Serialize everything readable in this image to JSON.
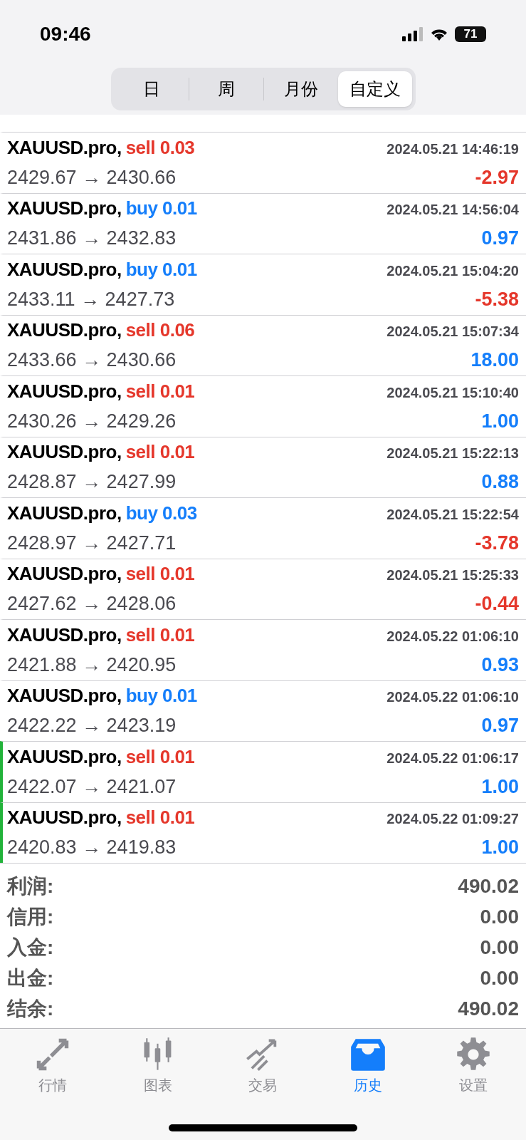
{
  "status_bar": {
    "time": "09:46",
    "battery": "71"
  },
  "period_tabs": [
    {
      "label": "日",
      "selected": false
    },
    {
      "label": "周",
      "selected": false
    },
    {
      "label": "月份",
      "selected": false
    },
    {
      "label": "自定义",
      "selected": true
    }
  ],
  "deals": [
    {
      "symbol": "XAUUSD.pro,",
      "sell": true,
      "lots": "sell 0.03",
      "time": "2024.05.21 14:46:19",
      "prices": "2429.67 → 2430.66",
      "profit": "-2.97",
      "loss": true,
      "marked": false
    },
    {
      "symbol": "XAUUSD.pro,",
      "sell": false,
      "lots": "buy 0.01",
      "time": "2024.05.21 14:56:04",
      "prices": "2431.86 → 2432.83",
      "profit": "0.97",
      "loss": false,
      "marked": false
    },
    {
      "symbol": "XAUUSD.pro,",
      "sell": false,
      "lots": "buy 0.01",
      "time": "2024.05.21 15:04:20",
      "prices": "2433.11 → 2427.73",
      "profit": "-5.38",
      "loss": true,
      "marked": false
    },
    {
      "symbol": "XAUUSD.pro,",
      "sell": true,
      "lots": "sell 0.06",
      "time": "2024.05.21 15:07:34",
      "prices": "2433.66 → 2430.66",
      "profit": "18.00",
      "loss": false,
      "marked": false
    },
    {
      "symbol": "XAUUSD.pro,",
      "sell": true,
      "lots": "sell 0.01",
      "time": "2024.05.21 15:10:40",
      "prices": "2430.26 → 2429.26",
      "profit": "1.00",
      "loss": false,
      "marked": false
    },
    {
      "symbol": "XAUUSD.pro,",
      "sell": true,
      "lots": "sell 0.01",
      "time": "2024.05.21 15:22:13",
      "prices": "2428.87 → 2427.99",
      "profit": "0.88",
      "loss": false,
      "marked": false
    },
    {
      "symbol": "XAUUSD.pro,",
      "sell": false,
      "lots": "buy 0.03",
      "time": "2024.05.21 15:22:54",
      "prices": "2428.97 → 2427.71",
      "profit": "-3.78",
      "loss": true,
      "marked": false
    },
    {
      "symbol": "XAUUSD.pro,",
      "sell": true,
      "lots": "sell 0.01",
      "time": "2024.05.21 15:25:33",
      "prices": "2427.62 → 2428.06",
      "profit": "-0.44",
      "loss": true,
      "marked": false
    },
    {
      "symbol": "XAUUSD.pro,",
      "sell": true,
      "lots": "sell 0.01",
      "time": "2024.05.22 01:06:10",
      "prices": "2421.88 → 2420.95",
      "profit": "0.93",
      "loss": false,
      "marked": false
    },
    {
      "symbol": "XAUUSD.pro,",
      "sell": false,
      "lots": "buy 0.01",
      "time": "2024.05.22 01:06:10",
      "prices": "2422.22 → 2423.19",
      "profit": "0.97",
      "loss": false,
      "marked": false
    },
    {
      "symbol": "XAUUSD.pro,",
      "sell": true,
      "lots": "sell 0.01",
      "time": "2024.05.22 01:06:17",
      "prices": "2422.07 → 2421.07",
      "profit": "1.00",
      "loss": false,
      "marked": true
    },
    {
      "symbol": "XAUUSD.pro,",
      "sell": true,
      "lots": "sell 0.01",
      "time": "2024.05.22 01:09:27",
      "prices": "2420.83 → 2419.83",
      "profit": "1.00",
      "loss": false,
      "marked": true
    }
  ],
  "summary": [
    {
      "label": "利润:",
      "value": "490.02"
    },
    {
      "label": "信用:",
      "value": "0.00"
    },
    {
      "label": "入金:",
      "value": "0.00"
    },
    {
      "label": "出金:",
      "value": "0.00"
    },
    {
      "label": "结余:",
      "value": "490.02"
    }
  ],
  "bottom_tabs": [
    {
      "kind": "quotes",
      "label": "行情",
      "selected": false
    },
    {
      "kind": "chart",
      "label": "图表",
      "selected": false
    },
    {
      "kind": "trade",
      "label": "交易",
      "selected": false
    },
    {
      "kind": "history",
      "label": "历史",
      "selected": true
    },
    {
      "kind": "settings",
      "label": "设置",
      "selected": false
    }
  ]
}
